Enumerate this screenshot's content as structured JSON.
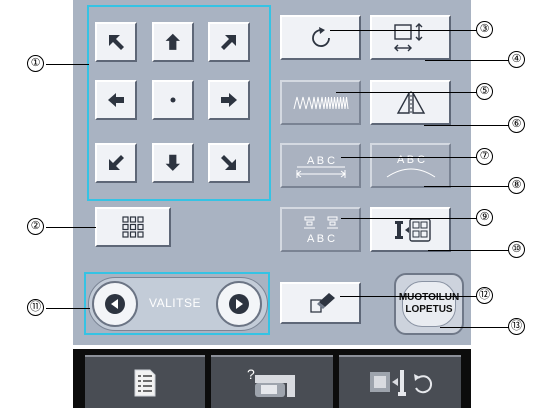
{
  "callouts": [
    "①",
    "②",
    "③",
    "④",
    "⑤",
    "⑥",
    "⑦",
    "⑧",
    "⑨",
    "⑩",
    "⑪",
    "⑫",
    "⑬"
  ],
  "selector": {
    "label": "VALITSE"
  },
  "end_edit_button": {
    "line1": "MUOTOILUN",
    "line2": "LOPETUS"
  },
  "text_layout": {
    "spacing_label": "A B C",
    "arc_label": "A B C",
    "vertical_label": "A B C"
  },
  "help_tab_glyph": "?",
  "colors": {
    "panel": "#a9b3c2",
    "highlight": "#35c3e4",
    "bottom_bar": "#0c0c0c"
  }
}
